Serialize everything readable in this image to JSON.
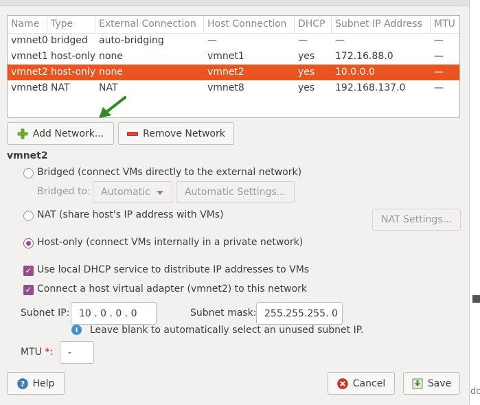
{
  "table": {
    "headers": [
      "Name",
      "Type",
      "External Connection",
      "Host Connection",
      "DHCP",
      "Subnet IP Address",
      "MTU"
    ],
    "rows": [
      {
        "name": "vmnet0",
        "type": "bridged",
        "external": "auto-bridging",
        "host": "—",
        "dhcp": "—",
        "subnet": "—",
        "mtu": "—"
      },
      {
        "name": "vmnet1",
        "type": "host-only",
        "external": "none",
        "host": "vmnet1",
        "dhcp": "yes",
        "subnet": "172.16.88.0",
        "mtu": "—"
      },
      {
        "name": "vmnet2",
        "type": "host-only",
        "external": "none",
        "host": "vmnet2",
        "dhcp": "yes",
        "subnet": "10.0.0.0",
        "mtu": "—"
      },
      {
        "name": "vmnet8",
        "type": "NAT",
        "external": "NAT",
        "host": "vmnet8",
        "dhcp": "yes",
        "subnet": "192.168.137.0",
        "mtu": "—"
      }
    ],
    "selected_index": 2
  },
  "buttons": {
    "add_network": "Add Network...",
    "remove_network": "Remove Network",
    "help": "Help",
    "cancel": "Cancel",
    "save": "Save"
  },
  "details": {
    "title": "vmnet2",
    "bridged_label": "Bridged (connect VMs directly to the external network)",
    "bridged_to_label": "Bridged to:",
    "bridged_to_value": "Automatic",
    "automatic_settings": "Automatic Settings...",
    "nat_label": "NAT (share host's IP address with VMs)",
    "nat_settings": "NAT Settings...",
    "hostonly_label": "Host-only (connect VMs internally in a private network)",
    "selected_mode": "host-only",
    "dhcp_label": "Use local DHCP service to distribute IP addresses to VMs",
    "dhcp_checked": true,
    "adapter_label": "Connect a host virtual adapter (vmnet2) to this network",
    "adapter_checked": true,
    "subnet_ip_label": "Subnet IP:",
    "subnet_ip_value": "10 . 0 . 0 . 0",
    "subnet_mask_label": "Subnet mask:",
    "subnet_mask_value": "255.255.255. 0",
    "hint": "Leave blank to automatically select an unused subnet IP.",
    "mtu_label": "MTU",
    "mtu_required": "*:",
    "mtu_value": "-"
  },
  "background_fragment": "do",
  "colors": {
    "selection": "#e95420",
    "accent": "#924d8b",
    "arrow": "#2e8b1e"
  },
  "icons": [
    "add-icon",
    "remove-icon",
    "arrow-pointer-icon",
    "dropdown-arrow-icon",
    "info-icon",
    "help-icon",
    "cancel-icon",
    "save-icon"
  ]
}
